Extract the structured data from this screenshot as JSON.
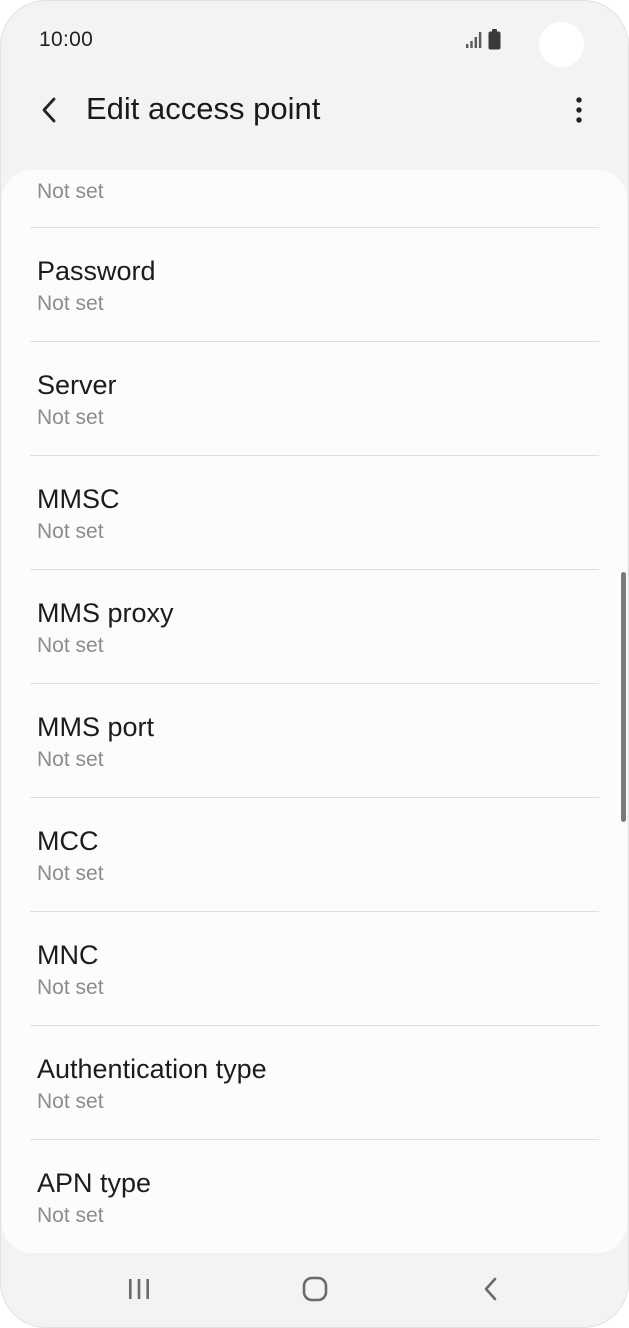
{
  "status_bar": {
    "time": "10:00",
    "icons": [
      "signal-icon",
      "battery-icon"
    ]
  },
  "app_bar": {
    "title": "Edit access point",
    "back_icon": "chevron-left-icon",
    "more_icon": "more-vertical-icon"
  },
  "list": {
    "partial_top_value": "Not set",
    "items": [
      {
        "title": "Password",
        "value": "Not set"
      },
      {
        "title": "Server",
        "value": "Not set"
      },
      {
        "title": "MMSC",
        "value": "Not set"
      },
      {
        "title": "MMS proxy",
        "value": "Not set"
      },
      {
        "title": "MMS port",
        "value": "Not set"
      },
      {
        "title": "MCC",
        "value": "Not set"
      },
      {
        "title": "MNC",
        "value": "Not set"
      },
      {
        "title": "Authentication type",
        "value": "Not set"
      },
      {
        "title": "APN type",
        "value": "Not set"
      }
    ]
  },
  "nav_bar": {
    "icons": [
      "recent-apps-icon",
      "home-icon",
      "back-icon"
    ]
  },
  "colors": {
    "background": "#f3f3f3",
    "card": "#fcfcfc",
    "title_text": "#1c1c1c",
    "secondary_text": "#8c8c8c",
    "divider": "#dedede"
  }
}
